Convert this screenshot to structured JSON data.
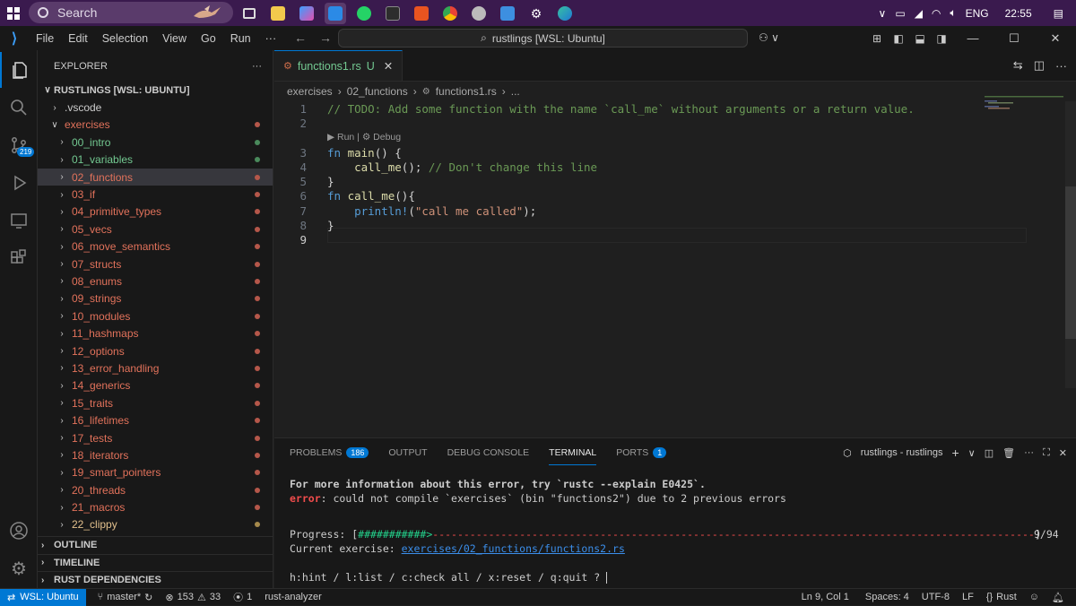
{
  "taskbar": {
    "search_placeholder": "Search",
    "language": "ENG",
    "time": "22:55"
  },
  "titlebar": {
    "menu": [
      "File",
      "Edit",
      "Selection",
      "View",
      "Go",
      "Run",
      "···"
    ],
    "command_center": "rustlings [WSL: Ubuntu]"
  },
  "activity": {
    "scm_badge": "219"
  },
  "sidebar": {
    "header": "EXPLORER",
    "root": "RUSTLINGS [WSL: UBUNTU]",
    "items": [
      {
        "label": ".vscode",
        "depth": 1,
        "color": "#cccccc",
        "dot": ""
      },
      {
        "label": "exercises",
        "depth": 1,
        "color": "#e2725b",
        "dot": "#b5574a",
        "open": true
      },
      {
        "label": "00_intro",
        "depth": 2,
        "color": "#73c991",
        "dot": "#4a8a5c"
      },
      {
        "label": "01_variables",
        "depth": 2,
        "color": "#73c991",
        "dot": "#4a8a5c"
      },
      {
        "label": "02_functions",
        "depth": 2,
        "color": "#e2725b",
        "dot": "#b5574a",
        "selected": true
      },
      {
        "label": "03_if",
        "depth": 2,
        "color": "#e2725b",
        "dot": "#b5574a"
      },
      {
        "label": "04_primitive_types",
        "depth": 2,
        "color": "#e2725b",
        "dot": "#b5574a"
      },
      {
        "label": "05_vecs",
        "depth": 2,
        "color": "#e2725b",
        "dot": "#b5574a"
      },
      {
        "label": "06_move_semantics",
        "depth": 2,
        "color": "#e2725b",
        "dot": "#b5574a"
      },
      {
        "label": "07_structs",
        "depth": 2,
        "color": "#e2725b",
        "dot": "#b5574a"
      },
      {
        "label": "08_enums",
        "depth": 2,
        "color": "#e2725b",
        "dot": "#b5574a"
      },
      {
        "label": "09_strings",
        "depth": 2,
        "color": "#e2725b",
        "dot": "#b5574a"
      },
      {
        "label": "10_modules",
        "depth": 2,
        "color": "#e2725b",
        "dot": "#b5574a"
      },
      {
        "label": "11_hashmaps",
        "depth": 2,
        "color": "#e2725b",
        "dot": "#b5574a"
      },
      {
        "label": "12_options",
        "depth": 2,
        "color": "#e2725b",
        "dot": "#b5574a"
      },
      {
        "label": "13_error_handling",
        "depth": 2,
        "color": "#e2725b",
        "dot": "#b5574a"
      },
      {
        "label": "14_generics",
        "depth": 2,
        "color": "#e2725b",
        "dot": "#b5574a"
      },
      {
        "label": "15_traits",
        "depth": 2,
        "color": "#e2725b",
        "dot": "#b5574a"
      },
      {
        "label": "16_lifetimes",
        "depth": 2,
        "color": "#e2725b",
        "dot": "#b5574a"
      },
      {
        "label": "17_tests",
        "depth": 2,
        "color": "#e2725b",
        "dot": "#b5574a"
      },
      {
        "label": "18_iterators",
        "depth": 2,
        "color": "#e2725b",
        "dot": "#b5574a"
      },
      {
        "label": "19_smart_pointers",
        "depth": 2,
        "color": "#e2725b",
        "dot": "#b5574a"
      },
      {
        "label": "20_threads",
        "depth": 2,
        "color": "#e2725b",
        "dot": "#b5574a"
      },
      {
        "label": "21_macros",
        "depth": 2,
        "color": "#e2725b",
        "dot": "#b5574a"
      },
      {
        "label": "22_clippy",
        "depth": 2,
        "color": "#e2c08d",
        "dot": "#a68a4c"
      }
    ],
    "sections": [
      "OUTLINE",
      "TIMELINE",
      "RUST DEPENDENCIES"
    ]
  },
  "editor": {
    "tab_label": "functions1.rs",
    "tab_status": "U",
    "breadcrumb": [
      "exercises",
      "02_functions",
      "functions1.rs",
      "..."
    ],
    "codelens": "▶ Run | ⚙ Debug",
    "lines": [
      {
        "n": "1",
        "segments": [
          {
            "t": "// TODO: Add some function with the name `call_me` without arguments or a return value.",
            "c": "#6a9955"
          }
        ]
      },
      {
        "n": "2",
        "segments": []
      },
      {
        "n": "3",
        "segments": [
          {
            "t": "fn ",
            "c": "#569cd6"
          },
          {
            "t": "main",
            "c": "#dcdcaa"
          },
          {
            "t": "() {",
            "c": "#d4d4d4"
          }
        ]
      },
      {
        "n": "4",
        "segments": [
          {
            "t": "    ",
            "c": "#d4d4d4"
          },
          {
            "t": "call_me",
            "c": "#dcdcaa"
          },
          {
            "t": "(); ",
            "c": "#d4d4d4"
          },
          {
            "t": "// Don't change this line",
            "c": "#6a9955"
          }
        ]
      },
      {
        "n": "5",
        "segments": [
          {
            "t": "}",
            "c": "#d4d4d4"
          }
        ]
      },
      {
        "n": "6",
        "segments": [
          {
            "t": "fn ",
            "c": "#569cd6"
          },
          {
            "t": "call_me",
            "c": "#dcdcaa"
          },
          {
            "t": "(){",
            "c": "#d4d4d4"
          }
        ]
      },
      {
        "n": "7",
        "segments": [
          {
            "t": "    ",
            "c": "#d4d4d4"
          },
          {
            "t": "println!",
            "c": "#569cd6"
          },
          {
            "t": "(",
            "c": "#d4d4d4"
          },
          {
            "t": "\"call me called\"",
            "c": "#ce9178"
          },
          {
            "t": ");",
            "c": "#d4d4d4"
          }
        ]
      },
      {
        "n": "8",
        "segments": [
          {
            "t": "}",
            "c": "#d4d4d4"
          }
        ]
      },
      {
        "n": "9",
        "segments": []
      }
    ]
  },
  "panel": {
    "tabs": [
      {
        "label": "PROBLEMS",
        "badge": "186"
      },
      {
        "label": "OUTPUT",
        "badge": ""
      },
      {
        "label": "DEBUG CONSOLE",
        "badge": ""
      },
      {
        "label": "TERMINAL",
        "badge": "",
        "selected": true
      },
      {
        "label": "PORTS",
        "badge": "1"
      }
    ],
    "terminal_name": "rustlings - rustlings",
    "terminal": {
      "line1": "For more information about this error, try `rustc --explain E0425`.",
      "line2_err": "error",
      "line2_rest": ": could not compile `exercises` (bin \"functions2\") due to 2 previous errors",
      "progress_label": "Progress: [",
      "progress_done": "###########>",
      "progress_rest": "-------------------------------------------------------------------------------------------------",
      "progress_end": "]",
      "progress_count": "9/94",
      "current_label": "Current exercise: ",
      "current_link": "exercises/02_functions/functions2.rs",
      "hint": "h:hint / l:list / c:check all / x:reset / q:quit ? "
    }
  },
  "statusbar": {
    "remote": "WSL: Ubuntu",
    "branch": "master*",
    "errors": "153",
    "warnings": "33",
    "ports": "1",
    "analyzer": "rust-analyzer",
    "position": "Ln 9, Col 1",
    "spaces": "Spaces: 4",
    "encoding": "UTF-8",
    "eol": "LF",
    "language": "Rust"
  }
}
